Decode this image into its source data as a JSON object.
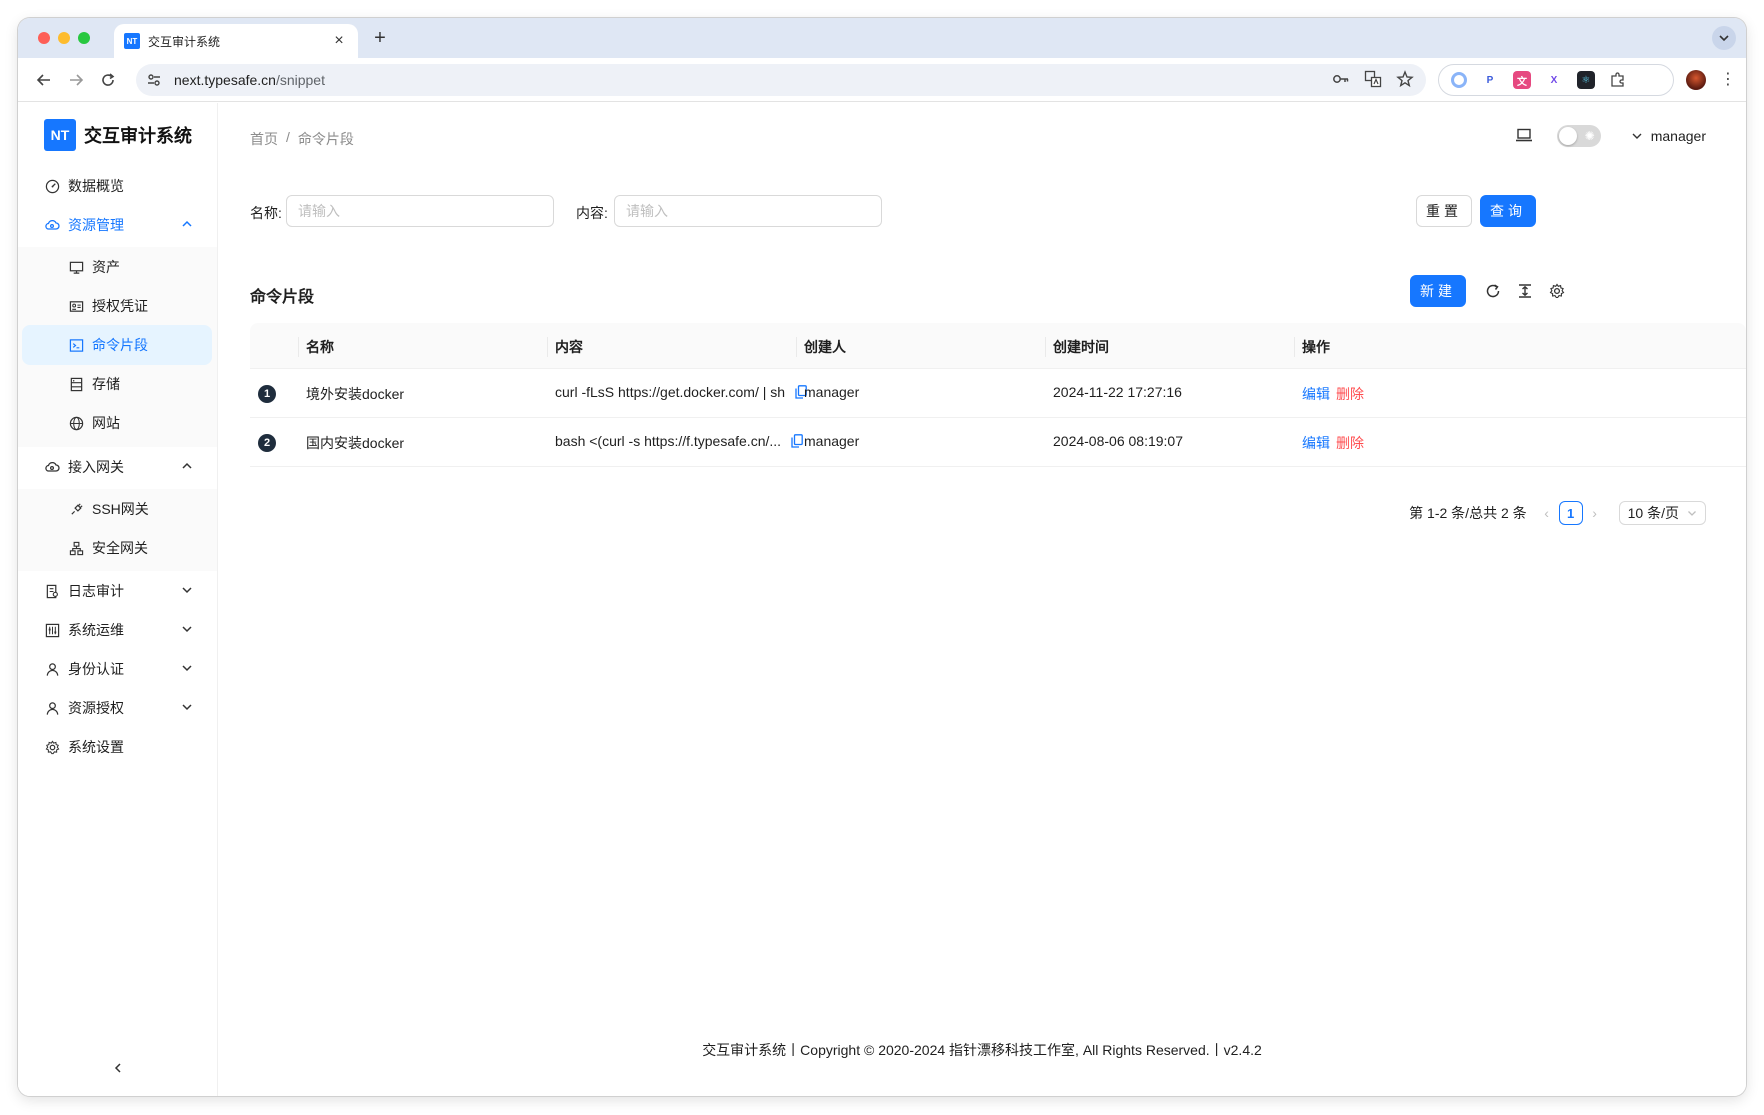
{
  "browser": {
    "tab_title": "交互审计系统",
    "tab_favicon": "NT",
    "url_host": "next.typesafe.cn",
    "url_path": "/snippet"
  },
  "app": {
    "brand_logo": "NT",
    "brand_name": "交互审计系统",
    "accent_color": "#1677ff",
    "danger_color": "#ff4d4f"
  },
  "sidebar": {
    "dashboard": "数据概览",
    "resource_mgmt": "资源管理",
    "resource_items": [
      "资产",
      "授权凭证",
      "命令片段",
      "存储",
      "网站"
    ],
    "gateway": "接入网关",
    "gateway_items": [
      "SSH网关",
      "安全网关"
    ],
    "log_audit": "日志审计",
    "sys_ops": "系统运维",
    "identity": "身份认证",
    "resource_auth": "资源授权",
    "sys_settings": "系统设置"
  },
  "header": {
    "breadcrumb_home": "首页",
    "breadcrumb_sep": "/",
    "breadcrumb_current": "命令片段",
    "username": "manager"
  },
  "search": {
    "name_label": "名称:",
    "name_placeholder": "请输入",
    "content_label": "内容:",
    "content_placeholder": "请输入",
    "reset_label": "重置",
    "query_label": "查询"
  },
  "table": {
    "title": "命令片段",
    "new_label": "新建",
    "columns": [
      "名称",
      "内容",
      "创建人",
      "创建时间",
      "操作"
    ],
    "rows": [
      {
        "index": "1",
        "name": "境外安装docker",
        "content": "curl -fLsS https://get.docker.com/ | sh",
        "creator": "manager",
        "created_at": "2024-11-22 17:27:16",
        "edit": "编辑",
        "delete": "删除"
      },
      {
        "index": "2",
        "name": "国内安装docker",
        "content": "bash <(curl -s https://f.typesafe.cn/...",
        "creator": "manager",
        "created_at": "2024-08-06 08:19:07",
        "edit": "编辑",
        "delete": "删除"
      }
    ]
  },
  "pagination": {
    "summary": "第 1-2 条/总共 2 条",
    "current_page": "1",
    "page_size": "10 条/页"
  },
  "footer": {
    "text": "交互审计系统丨Copyright © 2020-2024 指针漂移科技工作室, All Rights Reserved.丨v2.4.2"
  }
}
